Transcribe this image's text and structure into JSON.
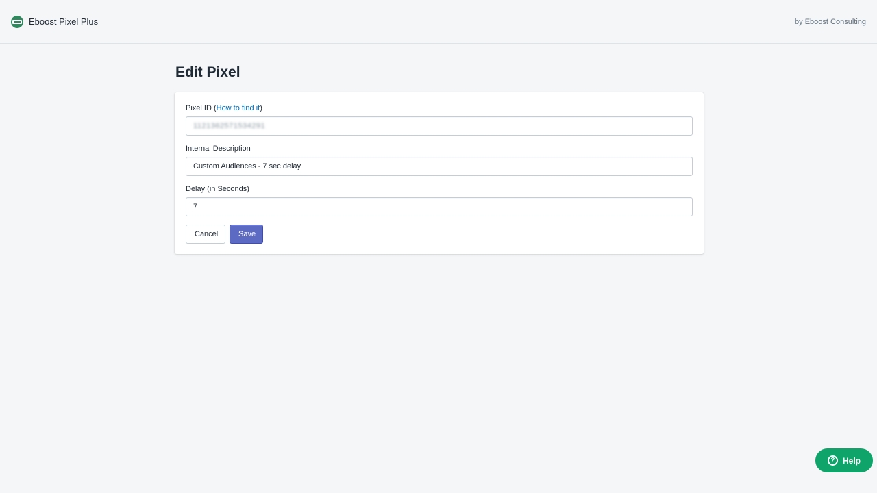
{
  "header": {
    "app_name": "Eboost Pixel Plus",
    "byline": "by Eboost Consulting",
    "logo_icon": "eboost-logo-icon"
  },
  "page": {
    "title": "Edit Pixel"
  },
  "form": {
    "pixel_id": {
      "label": "Pixel ID (",
      "link_text": "How to find it",
      "label_suffix": ")",
      "value": "1121362571534291"
    },
    "description": {
      "label": "Internal Description",
      "value": "Custom Audiences - 7 sec delay"
    },
    "delay": {
      "label": "Delay (in Seconds)",
      "value": "7"
    },
    "cancel_label": "Cancel",
    "save_label": "Save"
  },
  "help": {
    "label": "Help",
    "icon": "question-icon"
  },
  "colors": {
    "primary": "#5c6ac4",
    "help_green": "#0ea46a",
    "link": "#006fbb",
    "background": "#f4f6f8"
  }
}
